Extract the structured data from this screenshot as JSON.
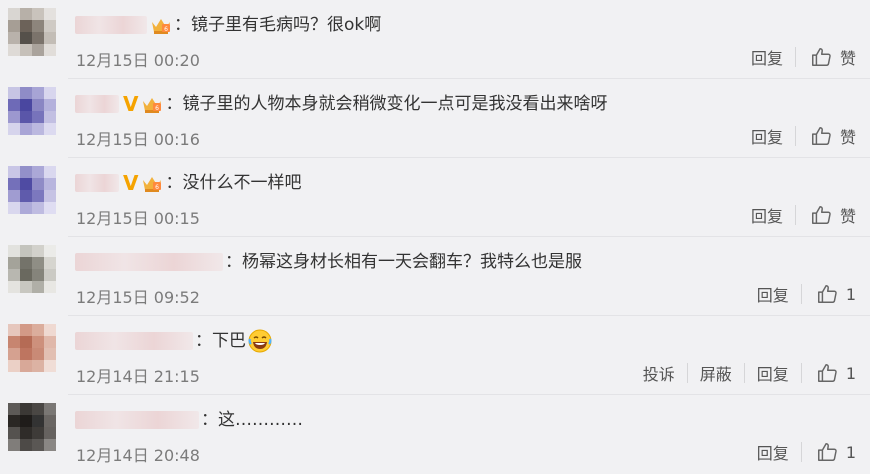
{
  "comments": [
    {
      "text": "：镜子里有毛病吗？很ok啊",
      "time": "12月15日 00:20",
      "reply": "回复",
      "like": "赞",
      "has_v": false,
      "avatar_colors": [
        "#d9d6d2",
        "#b7b0a8",
        "#c9c3bc",
        "#e4e1de",
        "#a69e95",
        "#6c6259",
        "#8d857c",
        "#cfcac4",
        "#b9b2ab",
        "#55504a",
        "#7b736b",
        "#c3bdb6",
        "#dedad6",
        "#c6c0b9",
        "#aaa39c",
        "#e1ddd9"
      ]
    },
    {
      "text": "：镜子里的人物本身就会稍微变化一点可是我没看出来啥呀",
      "time": "12月15日 00:16",
      "reply": "回复",
      "like": "赞",
      "has_v": true,
      "avatar_colors": [
        "#c7c5e4",
        "#8f8cc7",
        "#a7a4d5",
        "#d8d6ee",
        "#6e6ab7",
        "#4a47a0",
        "#8a86c3",
        "#b4b1dc",
        "#9c98cf",
        "#5a56a9",
        "#7773bb",
        "#c2bfe2",
        "#d6d4ec",
        "#a9a5d6",
        "#bbb8df",
        "#dcdaf0"
      ]
    },
    {
      "text": "：没什么不一样吧",
      "time": "12月15日 00:15",
      "reply": "回复",
      "like": "赞",
      "has_v": true,
      "avatar_colors": [
        "#c9c6e6",
        "#9390c9",
        "#aba8d7",
        "#dad8ef",
        "#7470ba",
        "#4f4ba3",
        "#8f8bc6",
        "#b8b5de",
        "#a09cd1",
        "#5f5bac",
        "#7c78be",
        "#c6c3e4",
        "#d9d7ee",
        "#adaad8",
        "#bfbce1",
        "#dfddf2"
      ]
    },
    {
      "text": "：杨幂这身材长相有一天会翻车？我特么也是服",
      "time": "12月15日 09:52",
      "reply": "回复",
      "like": "1",
      "has_v": false,
      "avatar_colors": [
        "#e2e2de",
        "#c4c4bd",
        "#d2d1cb",
        "#ebebe8",
        "#a4a39a",
        "#74736a",
        "#8f8e85",
        "#d6d5cf",
        "#b8b7b0",
        "#6a695f",
        "#85847b",
        "#cbcac4",
        "#e4e3df",
        "#c8c7c0",
        "#b0afa7",
        "#e8e7e3"
      ]
    },
    {
      "text": "：下巴",
      "time": "12月14日 21:15",
      "reply": "回复",
      "like": "1",
      "has_v": false,
      "has_emoji": true,
      "extra_actions": [
        "投诉",
        "屏蔽"
      ],
      "avatar_colors": [
        "#e6c7bd",
        "#d39a87",
        "#dbad9c",
        "#efd9d1",
        "#c78570",
        "#b56b55",
        "#cd907c",
        "#e0b8aa",
        "#d5a190",
        "#be7560",
        "#c98a76",
        "#e2bfb2",
        "#ebd0c6",
        "#d8a898",
        "#dcb2a3",
        "#f0ddd6"
      ]
    },
    {
      "text": "：这…………",
      "time": "12月14日 20:48",
      "reply": "回复",
      "like": "1",
      "has_v": false,
      "avatar_colors": [
        "#5d5a57",
        "#3b3835",
        "#4a4744",
        "#7a7774",
        "#2a2724",
        "#1f1c1a",
        "#333",
        "#6a6663",
        "#55524f",
        "#2f2c29",
        "#3e3b38",
        "#66625f",
        "#807d7a",
        "#4d4a47",
        "#5a5754",
        "#8a8784"
      ]
    }
  ]
}
